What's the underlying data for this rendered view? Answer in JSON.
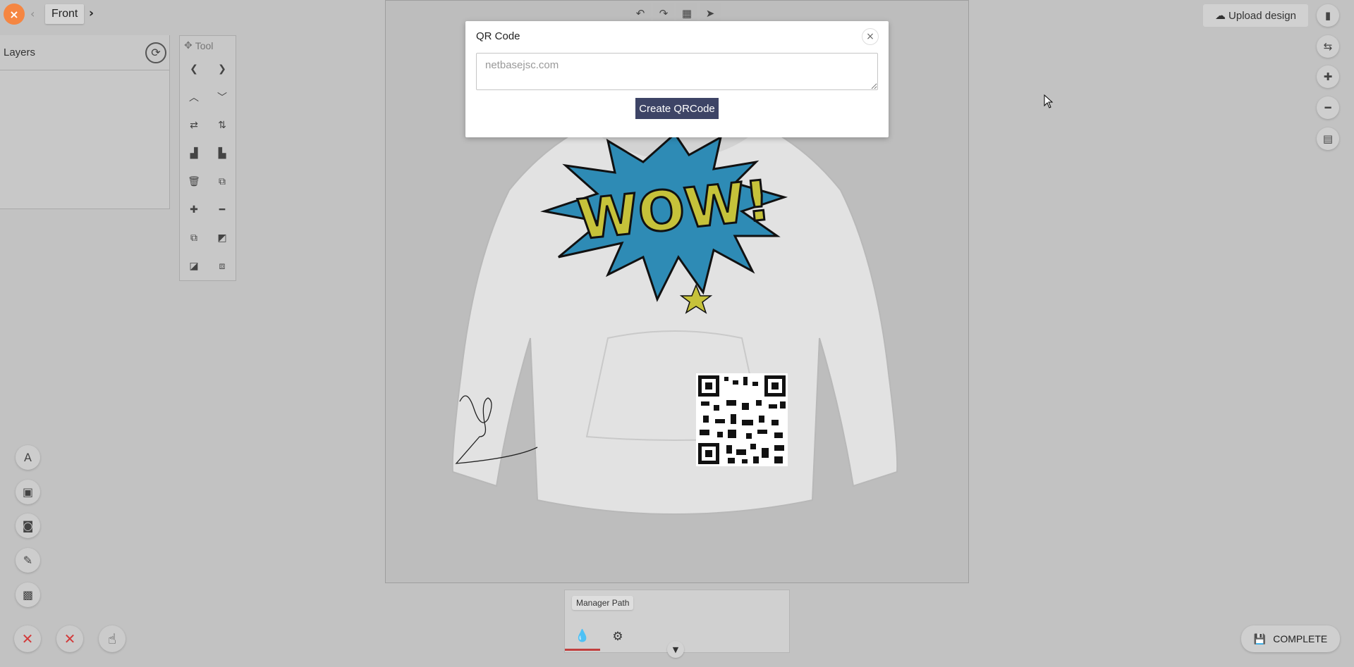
{
  "nav": {
    "close_icon": "×",
    "prev_icon": "‹",
    "view_label": "Front",
    "next_icon": "›"
  },
  "layers": {
    "title": "Layers"
  },
  "tool_panel": {
    "title": "Tool"
  },
  "modal": {
    "title": "QR Code",
    "input_value": "netbasejsc.com",
    "create_button": "Create QRCode",
    "close_icon": "×"
  },
  "upload": {
    "label": "Upload design"
  },
  "path_panel": {
    "label": "Manager Path"
  },
  "complete": {
    "label": "COMPLETE"
  },
  "colors": {
    "accent_orange": "#f58642",
    "primary_button": "#3d4466",
    "active_tab_underline": "#c2403f",
    "cancel_red": "#d23a3a"
  }
}
